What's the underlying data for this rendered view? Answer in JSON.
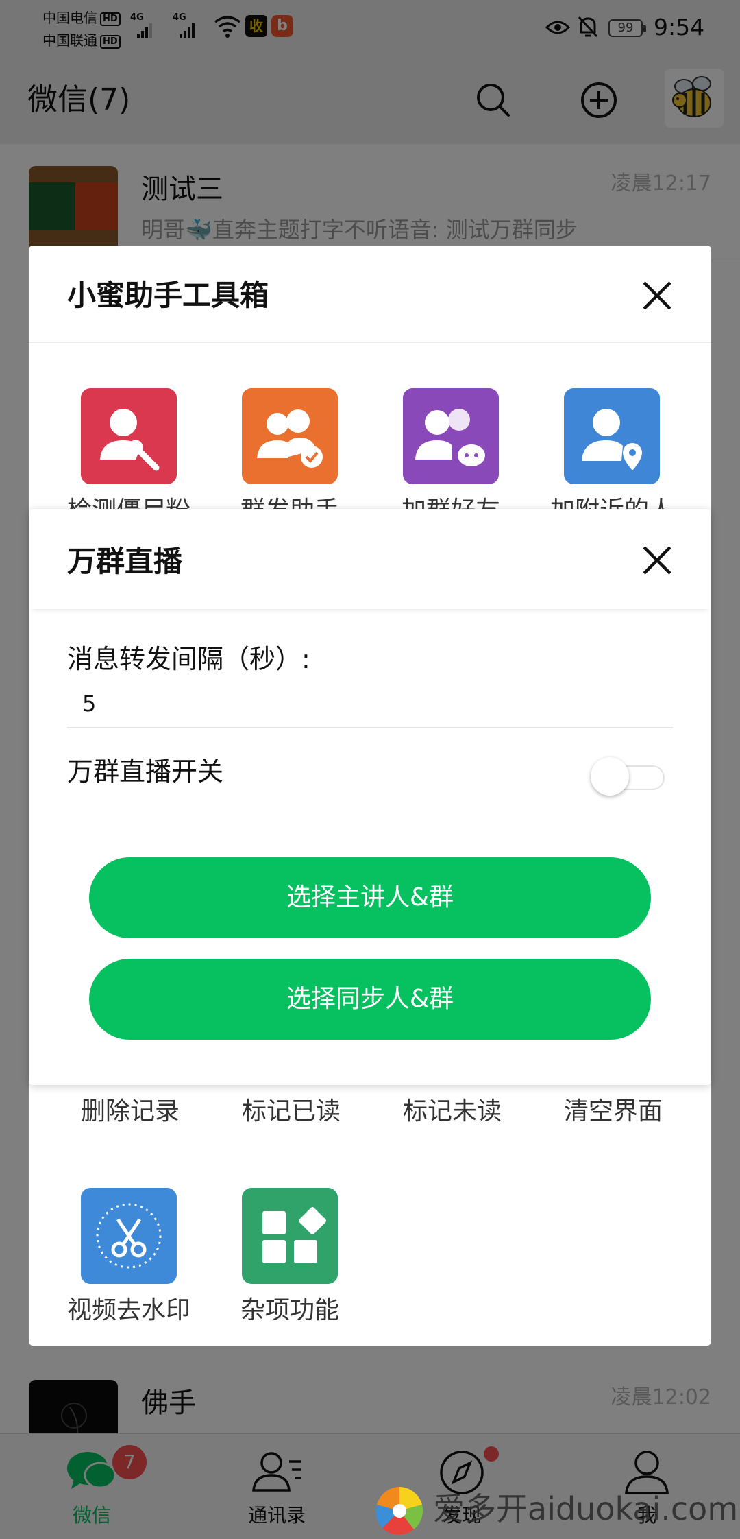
{
  "status_bar": {
    "carrier_1": "中国电信",
    "carrier_2": "中国联通",
    "hd": "HD",
    "network": "4G",
    "battery": "99",
    "time": "9:54"
  },
  "header": {
    "title": "微信(7)"
  },
  "chats": [
    {
      "name": "测试三",
      "time": "凌晨12:17",
      "preview": "明哥🐳直奔主题打字不听语音: 测试万群同步"
    },
    {
      "name": "佛手",
      "time": "凌晨12:02",
      "preview": ""
    }
  ],
  "toolbox": {
    "title": "小蜜助手工具箱",
    "tools_row1": [
      {
        "label": "检测僵尸粉",
        "icon": "user-wrench-icon",
        "color": "#d9384f"
      },
      {
        "label": "群发助手",
        "icon": "group-check-icon",
        "color": "#ea7030"
      },
      {
        "label": "加群好友",
        "icon": "group-chat-icon",
        "color": "#8a49b8"
      },
      {
        "label": "加附近的人",
        "icon": "user-location-icon",
        "color": "#3f86d6"
      }
    ],
    "tools_row3": [
      "删除记录",
      "标记已读",
      "标记未读",
      "清空界面"
    ],
    "tools_row4": [
      {
        "label": "视频去水印",
        "icon": "scissors-icon",
        "color": "#3f8ad8"
      },
      {
        "label": "杂项功能",
        "icon": "apps-icon",
        "color": "#2fa36a"
      }
    ]
  },
  "dialog": {
    "title": "万群直播",
    "interval_label": "消息转发间隔（秒）:",
    "interval_value": "5",
    "switch_label": "万群直播开关",
    "switch_on": false,
    "btn_speaker": "选择主讲人&群",
    "btn_sync": "选择同步人&群",
    "accent": "#07c160"
  },
  "bottom_nav": {
    "tabs": [
      {
        "label": "微信",
        "icon": "chat-icon",
        "badge": "7"
      },
      {
        "label": "通讯录",
        "icon": "contacts-icon"
      },
      {
        "label": "发现",
        "icon": "compass-icon"
      },
      {
        "label": "我",
        "icon": "person-icon"
      }
    ]
  },
  "watermark": {
    "text": "爱多开aiduokai.com"
  }
}
